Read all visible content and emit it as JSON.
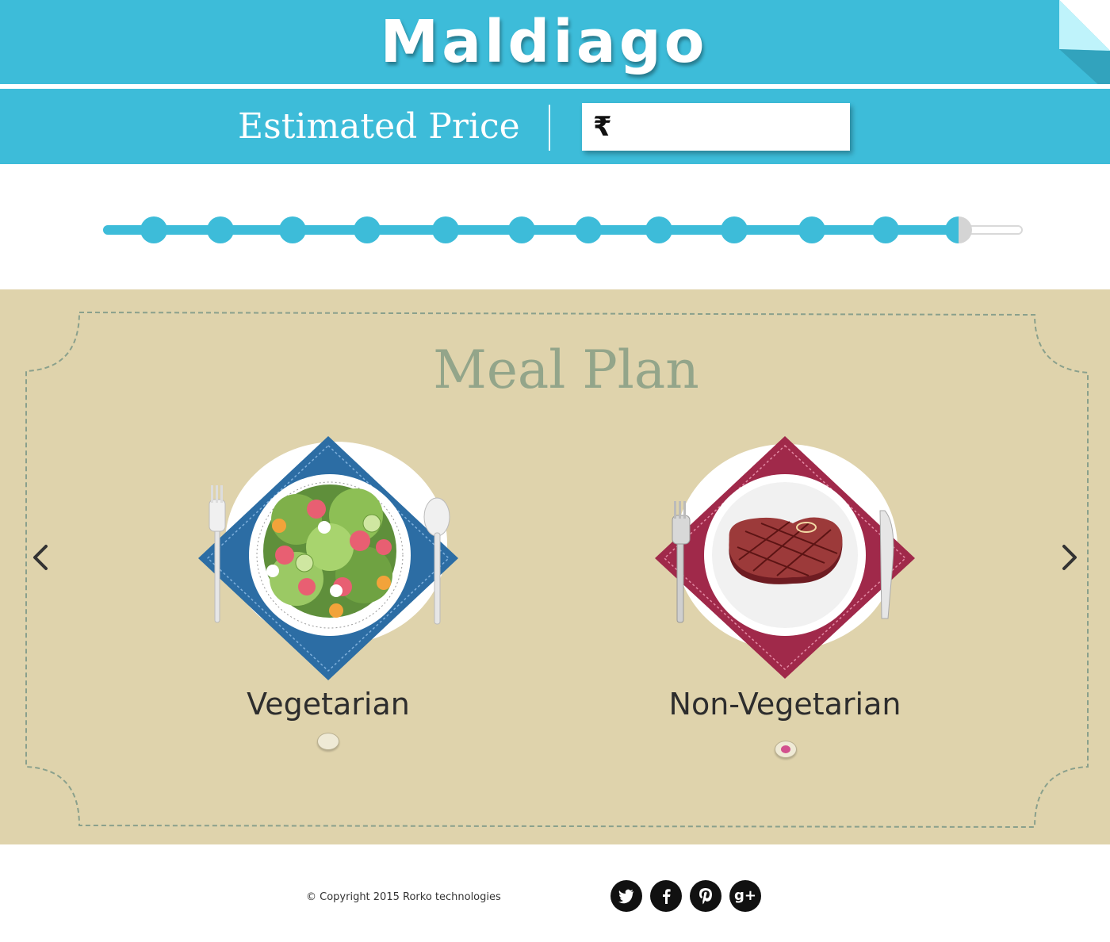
{
  "header": {
    "logo": "Maldiago",
    "price_label": "Estimated Price",
    "currency_symbol": "₹",
    "price_value": "",
    "accent_color": "#3dbcd9"
  },
  "slider": {
    "steps_total": 13,
    "current_step": 12,
    "progress": 0.93
  },
  "meal_plan": {
    "title": "Meal Plan",
    "background_color": "#dfd3ac",
    "options": [
      {
        "label": "Vegetarian",
        "selected": false
      },
      {
        "label": "Non-Vegetarian",
        "selected": true
      }
    ],
    "nav": {
      "prev_icon": "chevron-left-icon",
      "next_icon": "chevron-right-icon"
    }
  },
  "footer": {
    "copyright": "© Copyright 2015 Rorko technologies",
    "social": [
      {
        "name": "twitter-icon"
      },
      {
        "name": "facebook-icon"
      },
      {
        "name": "pinterest-icon"
      },
      {
        "name": "google-plus-icon",
        "glyph": "g+"
      }
    ]
  }
}
